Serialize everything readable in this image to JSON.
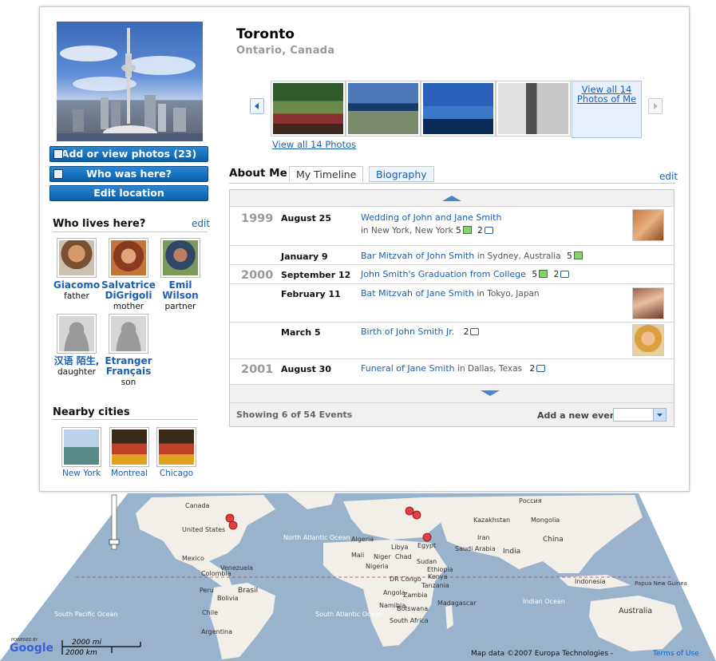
{
  "location": {
    "city": "Toronto",
    "region": "Ontario, Canada"
  },
  "actions": {
    "add_photos": "Add or view photos (23)",
    "who_was_here": "Who was here?",
    "edit_location": "Edit location"
  },
  "who_lives_here": {
    "title": "Who lives here?",
    "edit": "edit",
    "people": [
      {
        "name": "Giacomo",
        "relation": "father"
      },
      {
        "name": "Salvatrice DiGrigoli",
        "relation": "mother"
      },
      {
        "name": "Emil Wilson",
        "relation": "partner"
      },
      {
        "name": "汉语 陌生,",
        "relation": "daughter"
      },
      {
        "name": "Etranger Français",
        "relation": "son"
      }
    ]
  },
  "nearby": {
    "title": "Nearby cities",
    "cities": [
      "New York",
      "Montreal",
      "Chicago"
    ]
  },
  "photos": {
    "view_all_box": "View all 14 Photos of Me",
    "view_all_link": "View all 14 Photos"
  },
  "tabs": {
    "about": "About Me",
    "timeline": "My Timeline",
    "biography": "Biography",
    "edit": "edit"
  },
  "events": [
    {
      "year": "1999",
      "date": "August 25",
      "title": "Wedding of John and Jane Smith",
      "location": "in New York, New York",
      "photos": "5",
      "comments": "2"
    },
    {
      "year": "",
      "date": "January 9",
      "title": "Bar Mitzvah of John Smith",
      "location": "in Sydney, Australia",
      "photos": "5",
      "comments": ""
    },
    {
      "year": "2000",
      "date": "September 12",
      "title": "John Smith's Graduation from College",
      "location": "",
      "photos": "5",
      "comments": "2"
    },
    {
      "year": "",
      "date": "February 11",
      "title": "Bat Mitzvah of Jane Smith",
      "location": "in Tokyo, Japan",
      "photos": "",
      "comments": ""
    },
    {
      "year": "",
      "date": "March 5",
      "title": "Birth of John Smith Jr.",
      "location": "",
      "photos": "",
      "comments": "2"
    },
    {
      "year": "2001",
      "date": "August 30",
      "title": "Funeral of Jane Smith",
      "location": "in Dallas, Texas",
      "photos": "",
      "comments": "2"
    }
  ],
  "timeline_footer": {
    "showing": "Showing 6 of 54 Events",
    "add_event": "Add a new event"
  },
  "map": {
    "labels": {
      "united_states": "United States",
      "canada": "Canada",
      "mexico": "Mexico",
      "venezuela": "Venezuela",
      "colombia": "Colombia",
      "peru": "Peru",
      "bolivia": "Bolivia",
      "brasil": "Brasil",
      "chile": "Chile",
      "argentina": "Argentina",
      "algeria": "Algeria",
      "libya": "Libya",
      "egypt": "Egypt",
      "mali": "Mali",
      "niger": "Niger",
      "chad": "Chad",
      "sudan": "Sudan",
      "nigeria": "Nigeria",
      "ethiopia": "Ethiopia",
      "dr_congo": "DR Congo",
      "kenya": "Kenya",
      "tanzania": "Tanzania",
      "angola": "Angola",
      "zambia": "Zambia",
      "namibia": "Namibia",
      "botswana": "Botswana",
      "south_africa": "South Africa",
      "madagascar": "Madagascar",
      "saudi_arabia": "Saudi Arabia",
      "iran": "Iran",
      "kazakhstan": "Kazakhstan",
      "mongolia": "Mongolia",
      "china": "China",
      "india": "India",
      "russia": "Россия",
      "indonesia": "Indonesia",
      "australia": "Australia",
      "papua": "Papua New Guinea",
      "north_atlantic": "North Atlantic Ocean",
      "south_atlantic": "South Atlantic Ocean",
      "south_pacific": "South Pacific Ocean",
      "indian_ocean": "Indian Ocean"
    },
    "scale_mi": "2000 mi",
    "scale_km": "2000 km",
    "attribution": "Map data ©2007 Europa Technologies -",
    "terms": "Terms of Use",
    "powered": "POWERED BY",
    "google": "Google"
  },
  "colors": {
    "accent": "#1a5fb4",
    "button": "#0b5fa8",
    "ocean": "#99b3cc",
    "land": "#f2efe9"
  },
  "icons": [
    "photos-icon",
    "who-was-here-icon",
    "prev-arrow-icon",
    "next-arrow-icon",
    "scroll-up-icon",
    "scroll-down-icon",
    "dropdown-arrow-icon",
    "photo-icon",
    "comment-icon",
    "map-pin-icon"
  ]
}
